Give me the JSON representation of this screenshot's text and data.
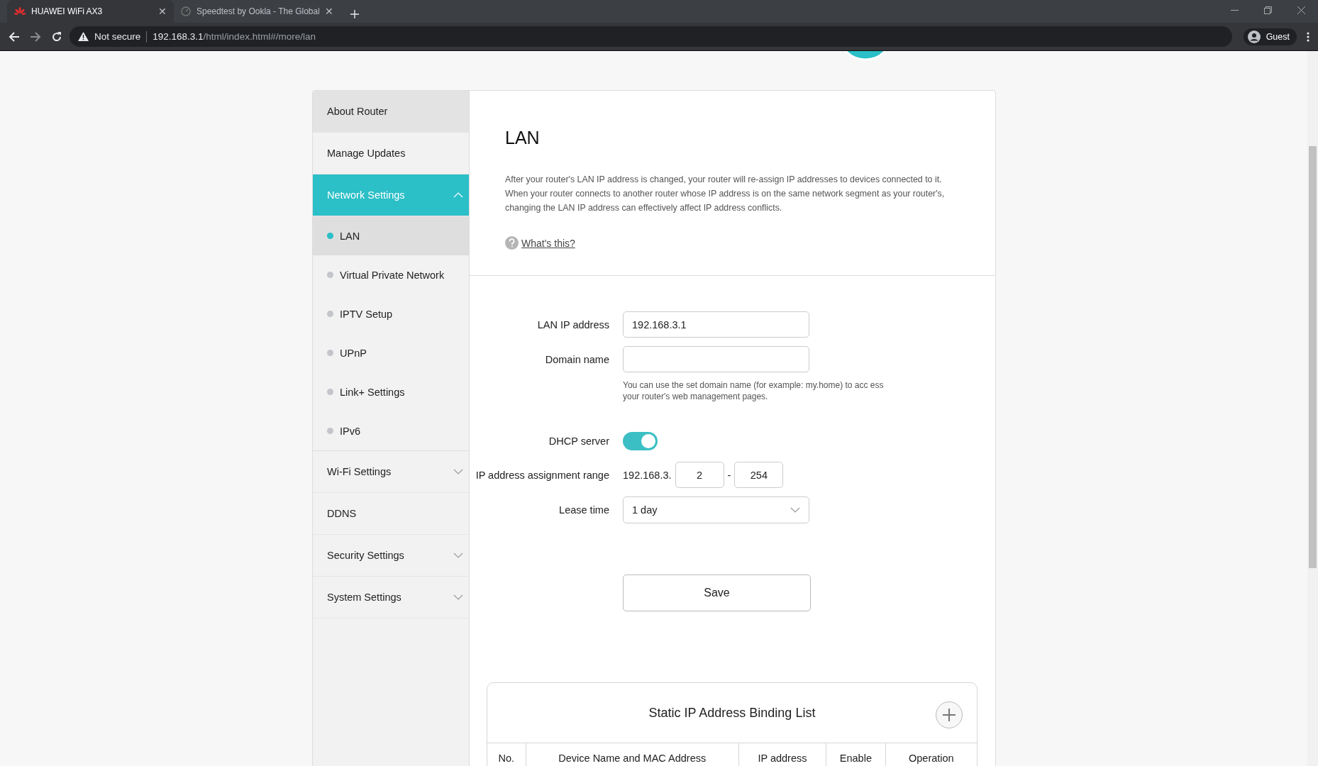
{
  "browser": {
    "tabs": [
      {
        "title": "HUAWEI WiFi AX3",
        "selected": true,
        "kind": "router",
        "close": "✕"
      },
      {
        "title": "Speedtest by Ookla - The Global",
        "selected": false,
        "kind": "speedtest",
        "close": "✕"
      }
    ],
    "address": {
      "security": "Not secure",
      "host": "192.168.3.1",
      "path": "/html/index.html#/more/lan"
    },
    "profile": "Guest"
  },
  "sidebar": {
    "items": [
      {
        "label": "About Router",
        "kind": "link",
        "selected": false,
        "hovered": true
      },
      {
        "label": "Manage Updates",
        "kind": "link",
        "selected": false,
        "hovered": false
      },
      {
        "label": "Network Settings",
        "kind": "group",
        "selected": true,
        "hovered": false,
        "expanded": true,
        "children": [
          {
            "label": "LAN",
            "selected": true
          },
          {
            "label": "Virtual Private Network",
            "selected": false
          },
          {
            "label": "IPTV Setup",
            "selected": false
          },
          {
            "label": "UPnP",
            "selected": false
          },
          {
            "label": "Link+ Settings",
            "selected": false
          },
          {
            "label": "IPv6",
            "selected": false
          }
        ]
      },
      {
        "label": "Wi-Fi Settings",
        "kind": "group",
        "selected": false,
        "hovered": false,
        "expanded": false
      },
      {
        "label": "DDNS",
        "kind": "link",
        "selected": false,
        "hovered": false
      },
      {
        "label": "Security Settings",
        "kind": "group",
        "selected": false,
        "hovered": false,
        "expanded": false
      },
      {
        "label": "System Settings",
        "kind": "group",
        "selected": false,
        "hovered": false,
        "expanded": false
      }
    ]
  },
  "page": {
    "title": "LAN",
    "description": "After your router's LAN IP address is changed, your router will re-assign IP addresses to devices connected to it. When your router connects to another router whose IP address is on the same network segment as your router's, changing the LAN IP address can effectively affect IP address conflicts.",
    "help_link": "What's this?",
    "fields": [
      {
        "kind": "text",
        "label": "LAN IP address",
        "value": "192.168.3.1"
      },
      {
        "kind": "text",
        "label": "Domain name",
        "hint": "You can use the set domain name (for example: my.home) to acc ess your router's web management pages."
      },
      {
        "kind": "toggle",
        "label": "DHCP server",
        "on": true
      },
      {
        "kind": "range",
        "label": "IP address assignment range",
        "prefix": "192.168.3.",
        "start": "2",
        "separator": "-",
        "end": "254"
      },
      {
        "kind": "select",
        "label": "Lease time",
        "value": "1 day"
      }
    ],
    "save_button": "Save",
    "table": {
      "title": "Static IP Address Binding List",
      "columns": [
        "No.",
        "Device Name and MAC Address",
        "IP address",
        "Enable",
        "Operation"
      ]
    }
  }
}
